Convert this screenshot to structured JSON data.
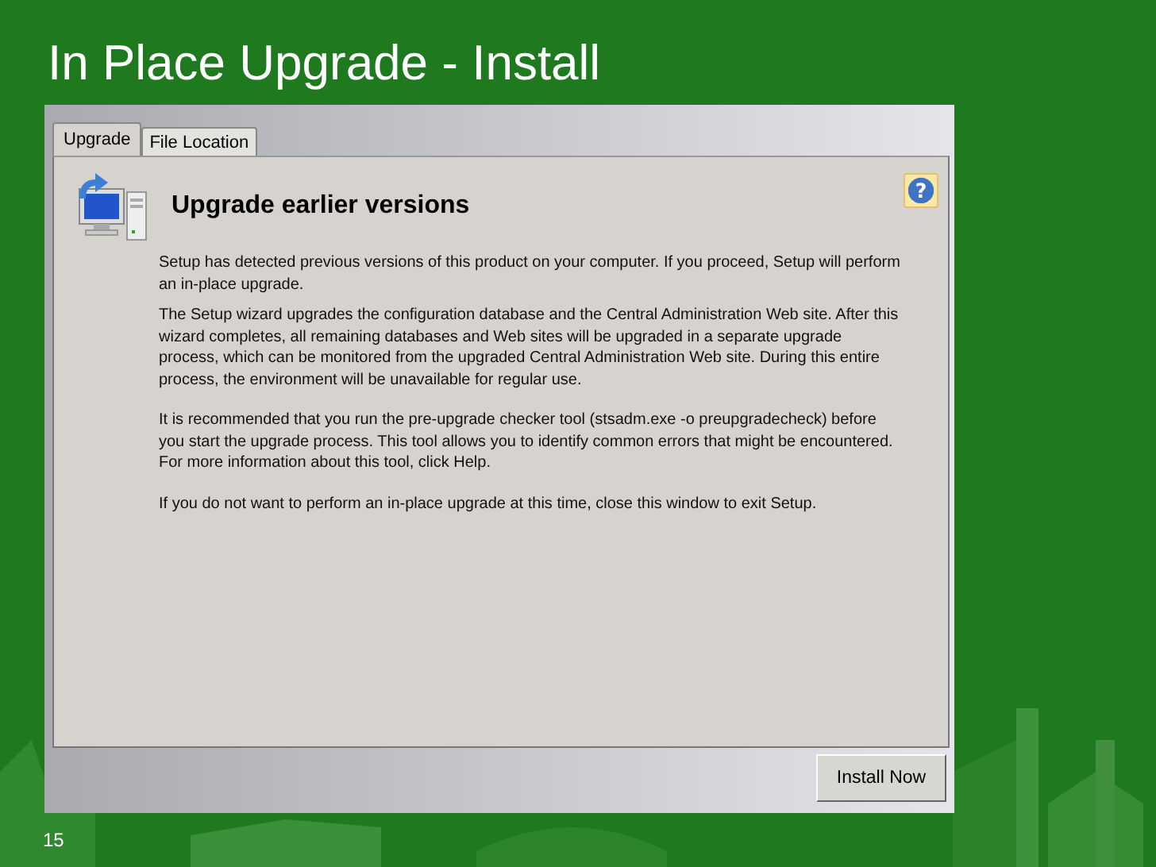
{
  "slide": {
    "title": "In Place Upgrade - Install",
    "page_number": "15"
  },
  "dialog": {
    "tabs": [
      {
        "label": "Upgrade",
        "selected": true
      },
      {
        "label": "File Location",
        "selected": false
      }
    ],
    "heading": "Upgrade earlier versions",
    "help_button": "?",
    "paragraphs": [
      "Setup has detected previous versions of this product on your computer. If you proceed, Setup will perform an in-place upgrade.",
      "The Setup wizard upgrades the configuration database and the Central Administration Web site. After this wizard completes, all remaining databases and Web sites will be upgraded in a separate upgrade process, which can be monitored from the upgraded Central Administration Web site. During this entire process, the environment will be unavailable for regular use.",
      "It is recommended that you run the pre-upgrade checker tool (stsadm.exe -o preupgradecheck) before you start the upgrade process. This tool allows you to identify common errors that might be encountered. For more information about this tool, click Help.",
      "If you do not want to perform an in-place upgrade at this time, close this window to exit Setup."
    ],
    "buttons": [
      "Install Now"
    ]
  }
}
